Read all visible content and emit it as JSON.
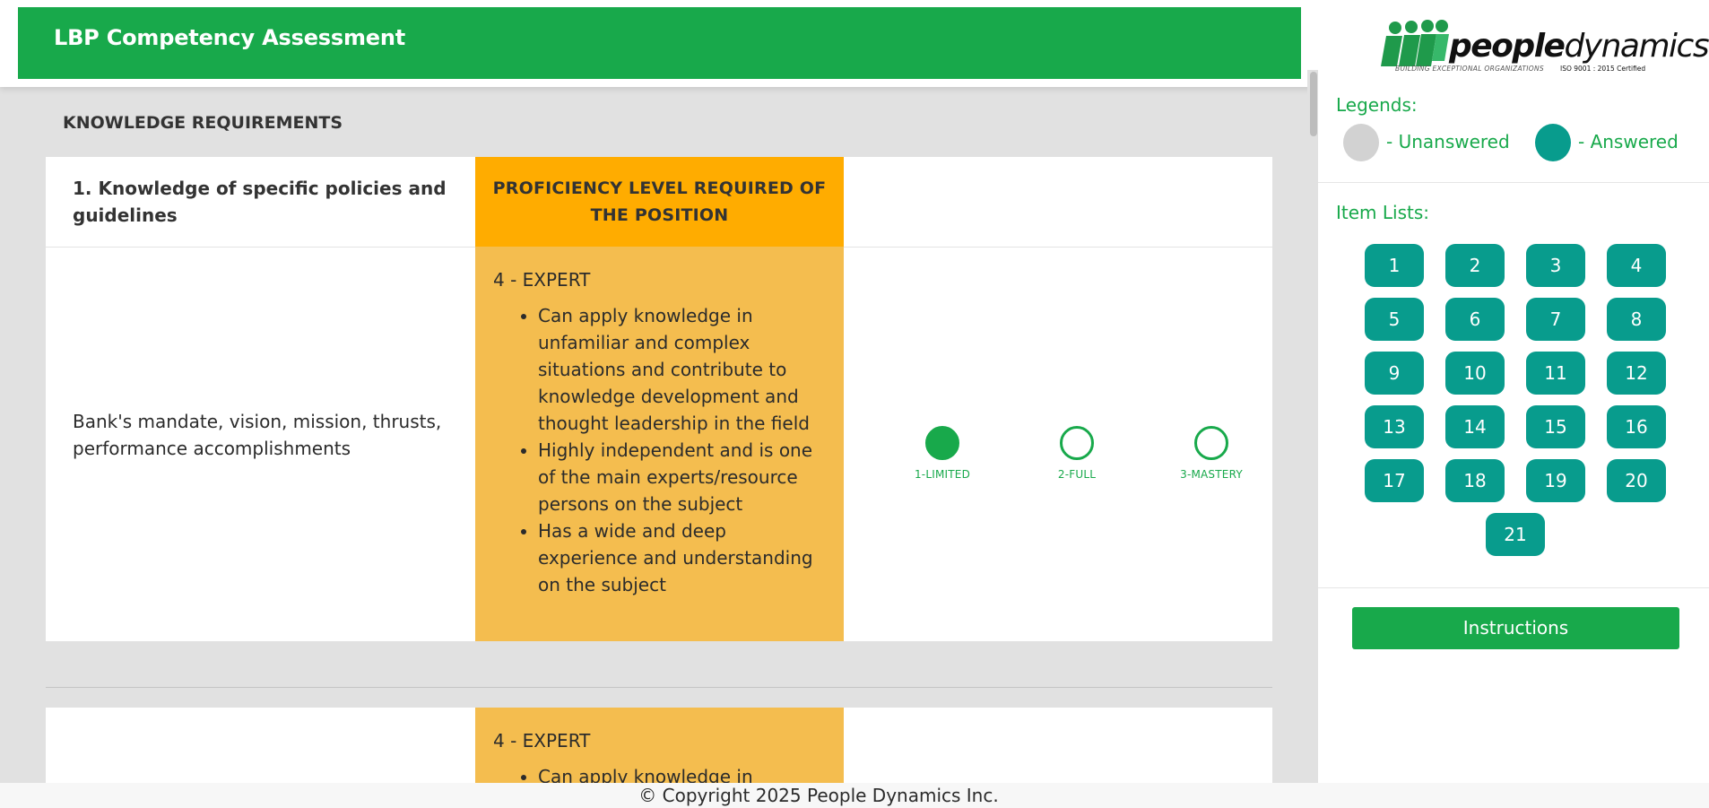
{
  "header": {
    "title": "LBP Competency Assessment"
  },
  "section": {
    "title": "KNOWLEDGE REQUIREMENTS"
  },
  "question_1": {
    "heading": "1. Knowledge of specific policies and guidelines",
    "proficiency_header": "PROFICIENCY LEVEL REQUIRED OF THE POSITION",
    "proficiency_level": "4 - EXPERT",
    "proficiency_bullets": [
      "Can apply knowledge in unfamiliar and complex situations and contribute to knowledge development and thought leadership in the field",
      "Highly independent and is one of the main experts/resource persons on the subject",
      "Has a wide and deep experience and understanding on the subject"
    ],
    "item_text": "Bank's mandate, vision, mission, thrusts, performance accomplishments",
    "options": [
      {
        "label": "1-LIMITED",
        "selected": true
      },
      {
        "label": "2-FULL",
        "selected": false
      },
      {
        "label": "3-MASTERY",
        "selected": false
      }
    ]
  },
  "question_2": {
    "proficiency_level": "4 - EXPERT",
    "proficiency_bullets": [
      "Can apply knowledge in"
    ]
  },
  "footer": {
    "copyright": "© Copyright 2025 People Dynamics Inc."
  },
  "sidebar": {
    "logo": {
      "brand_bold": "people",
      "brand_light": "dynamics",
      "tagline": "BUILDING EXCEPTIONAL ORGANIZATIONS",
      "iso": "ISO 9001 : 2015 Certified"
    },
    "legends_title": "Legends:",
    "legend_unanswered": "- Unanswered",
    "legend_answered": "- Answered",
    "items_title": "Item Lists:",
    "items": [
      "1",
      "2",
      "3",
      "4",
      "5",
      "6",
      "7",
      "8",
      "9",
      "10",
      "11",
      "12",
      "13",
      "14",
      "15",
      "16",
      "17",
      "18",
      "19",
      "20",
      "21"
    ],
    "instructions_label": "Instructions"
  },
  "colors": {
    "brand_green": "#18a94b",
    "answered_teal": "#089c8d",
    "unanswered_gray": "#d2d2d2",
    "proficiency_header": "#ffac00",
    "proficiency_body": "#f4bd4f"
  }
}
